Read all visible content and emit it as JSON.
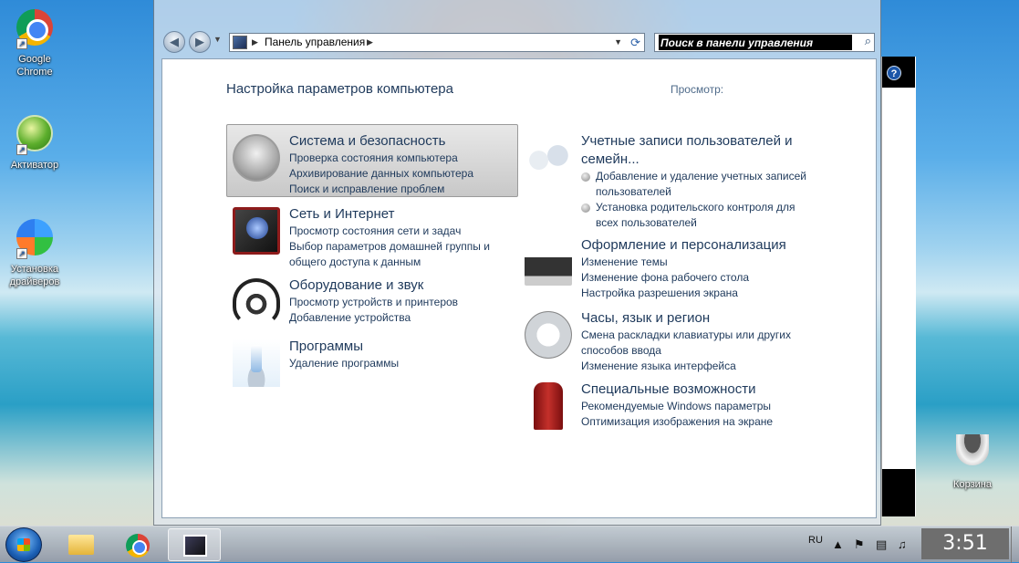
{
  "desktop": {
    "icons": [
      {
        "label_1": "Google",
        "label_2": "Chrome"
      },
      {
        "label_1": "Активатор"
      },
      {
        "label_1": "Установка",
        "label_2": "драйверов"
      },
      {
        "label_1": "Корзина"
      }
    ]
  },
  "window": {
    "address": {
      "path": "Панель управления"
    },
    "search": {
      "placeholder": "Поиск в панели управления"
    },
    "title": "Настройка параметров компьютера",
    "view_label": "Просмотр:",
    "help_icon": "?",
    "categories_left": [
      {
        "name": "system-security",
        "icon": "shield-icon",
        "title": "Система и безопасность",
        "links": [
          "Проверка состояния компьютера",
          "Архивирование данных компьютера",
          "Поиск и исправление проблем"
        ]
      },
      {
        "name": "network",
        "icon": "network-icon",
        "title": "Сеть и Интернет",
        "links": [
          "Просмотр состояния сети и задач",
          "Выбор параметров домашней группы и",
          "общего доступа к данным"
        ]
      },
      {
        "name": "hardware-sound",
        "icon": "headphones-icon",
        "title": "Оборудование и звук",
        "links": [
          "Просмотр устройств и принтеров",
          "Добавление устройства"
        ]
      },
      {
        "name": "programs",
        "icon": "programs-icon",
        "title": "Программы",
        "links": [
          "Удаление программы"
        ]
      }
    ],
    "categories_right": [
      {
        "name": "user-accounts",
        "icon": "users-icon",
        "title_1": "Учетные записи пользователей и",
        "title_2": "семейн...",
        "links": [
          "Добавление и удаление учетных записей",
          "пользователей",
          "Установка родительского контроля для",
          "всех пользователей"
        ]
      },
      {
        "name": "appearance",
        "icon": "personalization-icon",
        "title": "Оформление и персонализация",
        "links": [
          "Изменение темы",
          "Изменение фона рабочего стола",
          "Настройка разрешения экрана"
        ]
      },
      {
        "name": "clock-region",
        "icon": "clock-icon",
        "title": "Часы, язык и регион",
        "links": [
          "Смена раскладки клавиатуры или других",
          "способов ввода",
          "Изменение языка интерфейса"
        ]
      },
      {
        "name": "accessibility",
        "icon": "accessibility-icon",
        "title": "Специальные возможности",
        "links": [
          "Рекомендуемые Windows параметры",
          "Оптимизация изображения на экране"
        ]
      }
    ]
  },
  "taskbar": {
    "language": "RU",
    "time": "3:51"
  }
}
